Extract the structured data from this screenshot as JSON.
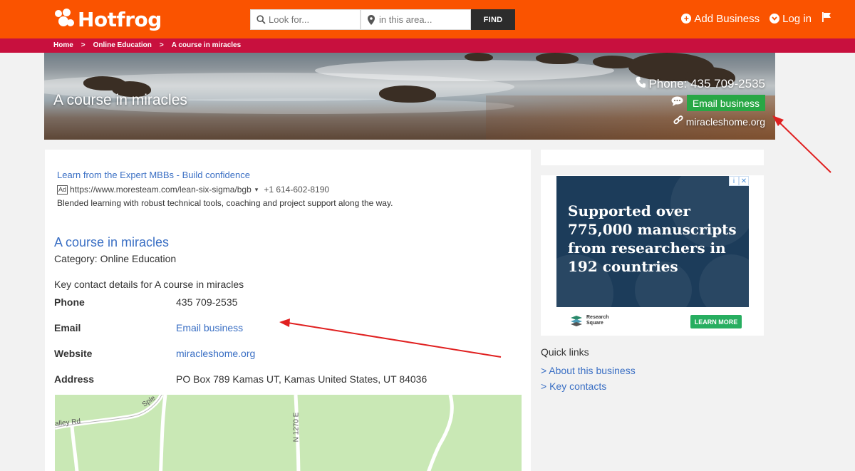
{
  "header": {
    "logo_text": "Hotfrog",
    "search_placeholder": "Look for...",
    "location_placeholder": "in this area...",
    "find_label": "FIND",
    "add_business_label": "Add Business",
    "login_label": "Log in"
  },
  "breadcrumb": {
    "items": [
      "Home",
      "Online Education",
      "A course in miracles"
    ],
    "separator": ">"
  },
  "hero": {
    "title": "A course in miracles",
    "phone": "Phone: 435 709-2535",
    "email_button": "Email business",
    "website": "miracleshome.org"
  },
  "ad": {
    "link_text": "Learn from the Expert MBBs - Build confidence",
    "badge": "Ad",
    "url": "https://www.moresteam.com/lean-six-sigma/bgb",
    "dropdown": "▾",
    "phone": "+1 614-602-8190",
    "description": "Blended learning with robust technical tools, coaching and project support along the way."
  },
  "business": {
    "name": "A course in miracles",
    "category": "Category: Online Education",
    "key_contacts_heading": "Key contact details for A course in miracles",
    "details": [
      {
        "label": "Phone",
        "value": "435 709-2535"
      },
      {
        "label": "Email",
        "value": "Email business"
      },
      {
        "label": "Website",
        "value": "miracleshome.org"
      },
      {
        "label": "Address",
        "value": "PO Box 789 Kamas UT, Kamas United States, UT 84036"
      }
    ]
  },
  "map": {
    "road_labels": [
      "Sple",
      "alley Rd",
      "N 1270 E"
    ]
  },
  "sidebar_ad": {
    "headline": "Supported over 775,000 manuscripts from researchers in 192 countries",
    "brand_line1": "Research",
    "brand_line2": "Square",
    "cta": "LEARN MORE"
  },
  "quick_links": {
    "title": "Quick links",
    "items": [
      "> About this business",
      "> Key contacts"
    ]
  },
  "colors": {
    "brand_orange": "#fa5300",
    "breadcrumb_red": "#c8103e",
    "link_blue": "#3a6fc4",
    "email_green": "#28a745",
    "annotation_red": "#e02020"
  }
}
